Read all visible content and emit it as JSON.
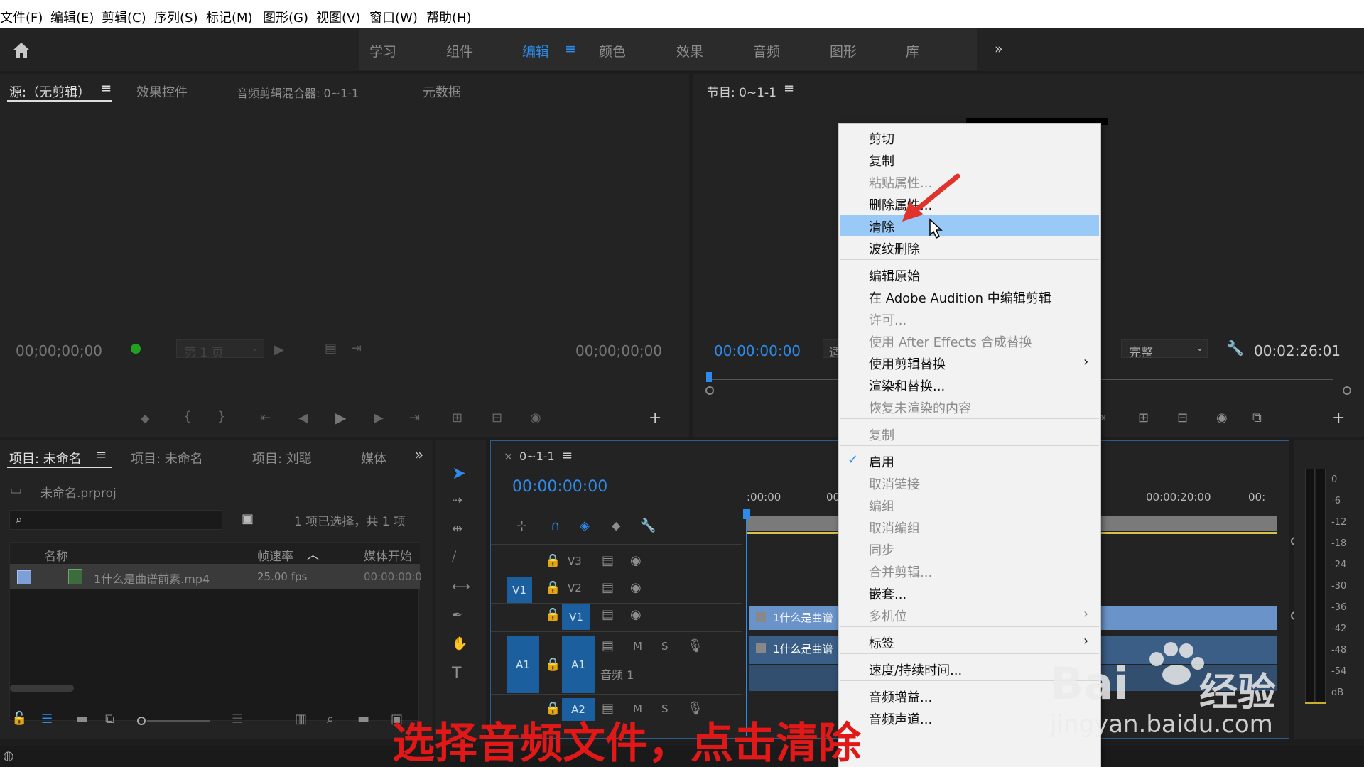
{
  "menubar": [
    "文件(F)",
    "编辑(E)",
    "剪辑(C)",
    "序列(S)",
    "标记(M)",
    "图形(G)",
    "视图(V)",
    "窗口(W)",
    "帮助(H)"
  ],
  "workspaces": [
    "学习",
    "组件",
    "编辑",
    "颜色",
    "效果",
    "音频",
    "图形",
    "库"
  ],
  "source_panel": {
    "tabs": [
      "源:（无剪辑）",
      "效果控件",
      "音频剪辑混合器: 0~1-1",
      "元数据"
    ],
    "tc_left": "00;00;00;00",
    "tc_right": "00;00;00;00",
    "page_label": "第 1 页"
  },
  "program_panel": {
    "title": "节目: 0~1-1",
    "tc_left": "00:00:00:00",
    "fit_partial": "适",
    "quality": "完整",
    "duration": "00:02:26:01"
  },
  "project_panel": {
    "tabs": [
      "项目: 未命名",
      "项目: 未命名",
      "项目: 刘聪",
      "媒体"
    ],
    "file": "未命名.prproj",
    "selection": "1 项已选择，共 1 项",
    "columns": [
      "名称",
      "帧速率",
      "媒体开始"
    ],
    "row": {
      "name": "1什么是曲谱前素.mp4",
      "fps": "25.00 fps",
      "start": "00:00:00:0"
    }
  },
  "timeline": {
    "close": "×",
    "title": "0~1-1",
    "tc": "00:00:00:00",
    "ruler": [
      ":00:00",
      "00:",
      "00:00:20:00",
      "00:"
    ],
    "tracks": {
      "v3": "V3",
      "v2": "V2",
      "v1": "V1",
      "v1src": "V1",
      "a1": "A1",
      "a1src": "A1",
      "a2": "A2",
      "m": "M",
      "s": "S",
      "audio_name": "音频 1"
    },
    "clip_v": "1什么是曲谱",
    "clip_a": "1什么是曲谱"
  },
  "meter": {
    "scale": [
      "0",
      "-6",
      "-12",
      "-18",
      "-24",
      "-30",
      "-36",
      "-42",
      "-48",
      "-54",
      "dB"
    ]
  },
  "context_menu": [
    {
      "label": "剪切",
      "disabled": false
    },
    {
      "label": "复制",
      "disabled": false
    },
    {
      "label": "粘贴属性...",
      "disabled": true
    },
    {
      "label": "删除属性...",
      "disabled": false
    },
    {
      "label": "清除",
      "disabled": false,
      "highlight": true
    },
    {
      "label": "波纹删除",
      "disabled": false,
      "sep_after": true
    },
    {
      "label": "编辑原始",
      "disabled": false
    },
    {
      "label": "在 Adobe Audition 中编辑剪辑",
      "disabled": false
    },
    {
      "label": "许可...",
      "disabled": true
    },
    {
      "label": "使用 After Effects 合成替换",
      "disabled": true
    },
    {
      "label": "使用剪辑替换",
      "disabled": false,
      "submenu": true
    },
    {
      "label": "渲染和替换...",
      "disabled": false
    },
    {
      "label": "恢复未渲染的内容",
      "disabled": true,
      "sep_after": true
    },
    {
      "label": "复制",
      "disabled": true,
      "sep_after": true
    },
    {
      "label": "启用",
      "disabled": false,
      "checked": true
    },
    {
      "label": "取消链接",
      "disabled": true
    },
    {
      "label": "编组",
      "disabled": true
    },
    {
      "label": "取消编组",
      "disabled": true
    },
    {
      "label": "同步",
      "disabled": true
    },
    {
      "label": "合并剪辑...",
      "disabled": true
    },
    {
      "label": "嵌套...",
      "disabled": false
    },
    {
      "label": "多机位",
      "disabled": true,
      "submenu": true,
      "sep_after": true
    },
    {
      "label": "标签",
      "disabled": false,
      "submenu": true,
      "sep_after": true
    },
    {
      "label": "速度/持续时间...",
      "disabled": false,
      "sep_after": true
    },
    {
      "label": "音频增益...",
      "disabled": false
    },
    {
      "label": "音频声道...",
      "disabled": false
    }
  ],
  "caption": "选择音频文件，点击清除",
  "watermark": {
    "brand": "Bai",
    "brand_cn": "经验",
    "url": "jingyan.baidu.com"
  },
  "colors": {
    "accent": "#2d8ceb",
    "highlight": "#99c9f7",
    "caption": "#e01818"
  }
}
